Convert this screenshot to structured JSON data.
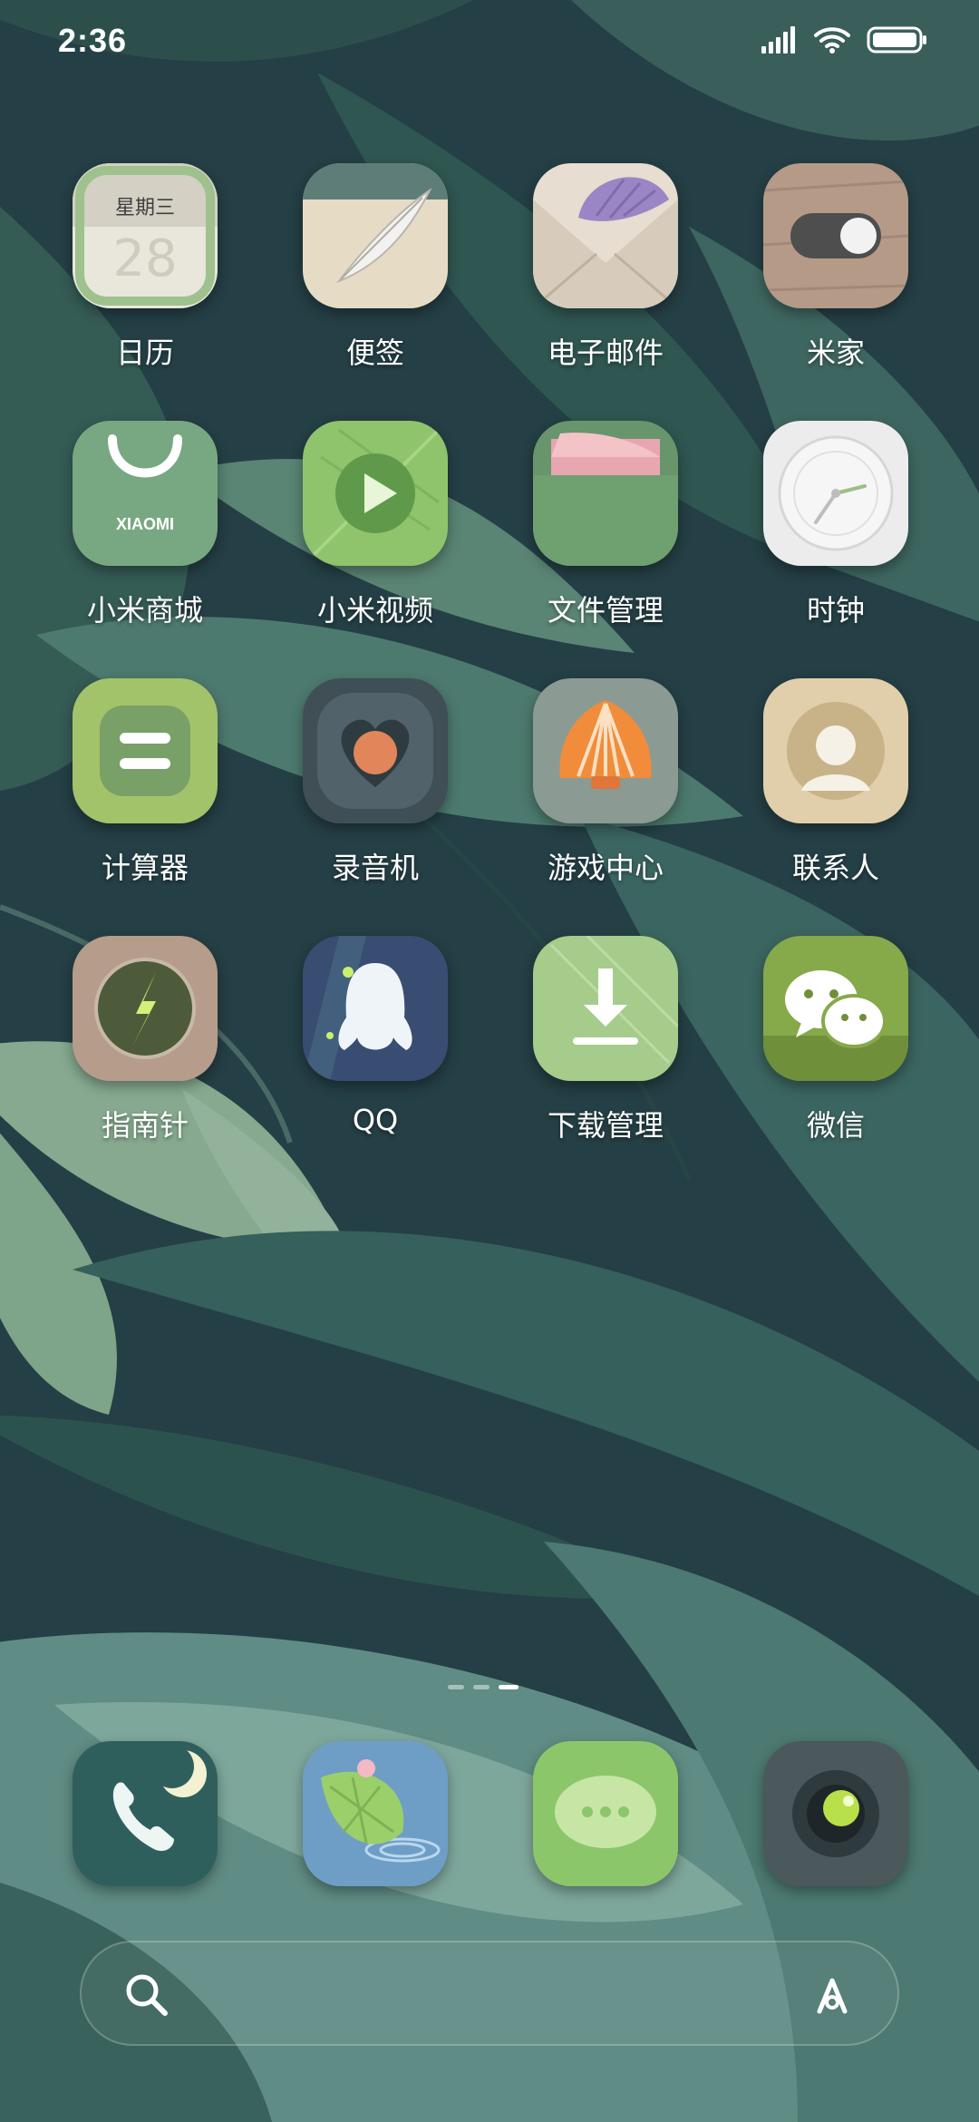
{
  "status_bar": {
    "time": "2:36",
    "icons": [
      "signal-icon",
      "wifi-icon",
      "battery-icon"
    ]
  },
  "home_apps": [
    {
      "name": "calendar",
      "label": "日历",
      "icon_text_weekday": "星期三",
      "icon_text_day": "28"
    },
    {
      "name": "notes",
      "label": "便签"
    },
    {
      "name": "email",
      "label": "电子邮件"
    },
    {
      "name": "mijia",
      "label": "米家"
    },
    {
      "name": "xiaomi-store",
      "label": "小米商城",
      "icon_text": "XIAOMI"
    },
    {
      "name": "mi-video",
      "label": "小米视频"
    },
    {
      "name": "file-manager",
      "label": "文件管理"
    },
    {
      "name": "clock",
      "label": "时钟"
    },
    {
      "name": "calculator",
      "label": "计算器"
    },
    {
      "name": "recorder",
      "label": "录音机"
    },
    {
      "name": "game-center",
      "label": "游戏中心"
    },
    {
      "name": "contacts",
      "label": "联系人"
    },
    {
      "name": "compass",
      "label": "指南针"
    },
    {
      "name": "qq",
      "label": "QQ"
    },
    {
      "name": "downloads",
      "label": "下载管理"
    },
    {
      "name": "wechat",
      "label": "微信"
    }
  ],
  "page_indicator": {
    "pages": 3,
    "current": 3
  },
  "dock_apps": [
    {
      "name": "phone",
      "icon": "phone-icon"
    },
    {
      "name": "gallery",
      "icon": "gallery-icon"
    },
    {
      "name": "messages",
      "icon": "messages-icon"
    },
    {
      "name": "camera",
      "icon": "camera-icon"
    }
  ],
  "search_bar": {
    "left_icon": "search-icon",
    "right_icon": "assistant-icon"
  },
  "colors": {
    "wallpaper_dark": "#1f3a37",
    "leaf": "#3f6a63",
    "leaf_light": "#8fb09a",
    "label": "#ffffff"
  }
}
